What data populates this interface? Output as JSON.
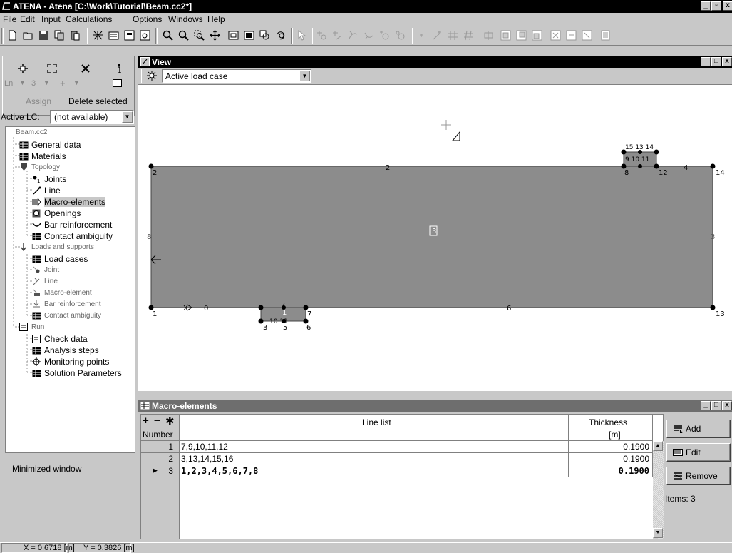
{
  "window": {
    "title": "ATENA - Atena [C:\\Work\\Tutorial\\Beam.cc2*]",
    "min": "_",
    "max": "▫",
    "close": "x"
  },
  "menu": [
    "File",
    "Edit",
    "Input",
    "Calculations",
    "Options",
    "Windows",
    "Help"
  ],
  "left": {
    "ln_label": "Ln",
    "ln_value": "3",
    "assign_label": "Assign",
    "delete_label": "Delete selected",
    "active_lc_label": "Active LC:",
    "active_lc_value": "(not available)",
    "tree": [
      {
        "label": "Beam.cc2",
        "small": true
      },
      {
        "label": "General data"
      },
      {
        "label": "Materials"
      },
      {
        "label": "Topology",
        "small": true
      },
      {
        "label": "Joints"
      },
      {
        "label": "Line"
      },
      {
        "label": "Macro-elements",
        "selected": true
      },
      {
        "label": "Openings"
      },
      {
        "label": "Bar reinforcement"
      },
      {
        "label": "Contact ambiguity"
      },
      {
        "label": "Loads and supports",
        "small": true
      },
      {
        "label": "Load cases"
      },
      {
        "label": "Joint",
        "small": true
      },
      {
        "label": "Line",
        "small": true
      },
      {
        "label": "Macro-element",
        "small": true
      },
      {
        "label": "Bar reinforcement",
        "small": true
      },
      {
        "label": "Contact ambiguity",
        "small": true
      },
      {
        "label": "Run",
        "small": true
      },
      {
        "label": "Check data"
      },
      {
        "label": "Analysis steps"
      },
      {
        "label": "Monitoring points"
      },
      {
        "label": "Solution Parameters"
      }
    ],
    "minimized": "Minimized window"
  },
  "view": {
    "title": "View",
    "load_case": "Active load case",
    "labels": {
      "j1": "1",
      "j2": "2",
      "j3": "3",
      "j4": "4",
      "j5": "5",
      "j6": "6",
      "j7": "7",
      "j8": "8",
      "j12": "12",
      "j13": "13",
      "j14": "14",
      "l2": "2",
      "l4": "4",
      "l6": "6",
      "l8": "8",
      "l7": "7",
      "l3": "3",
      "m3": "3",
      "m1": "1",
      "top": "15 13 14",
      "topb": "9 10 11",
      "bot": "10 11",
      "x0": "0"
    }
  },
  "macro": {
    "title": "Macro-elements",
    "col_number": "Number",
    "col_lines": "Line list",
    "col_thick": "Thickness",
    "col_unit": "[m]",
    "rows": [
      {
        "num": "1",
        "lines": "7,9,10,11,12",
        "thick": "0.1900"
      },
      {
        "num": "2",
        "lines": "3,13,14,15,16",
        "thick": "0.1900"
      },
      {
        "num": "3",
        "lines": "1,2,3,4,5,6,7,8",
        "thick": "0.1900"
      }
    ],
    "add": "Add",
    "edit": "Edit",
    "remove": "Remove",
    "items": "Items: 3"
  },
  "status": {
    "x": "X = 0.6718 [m]",
    "y": "Y = 0.3826 [m]"
  }
}
